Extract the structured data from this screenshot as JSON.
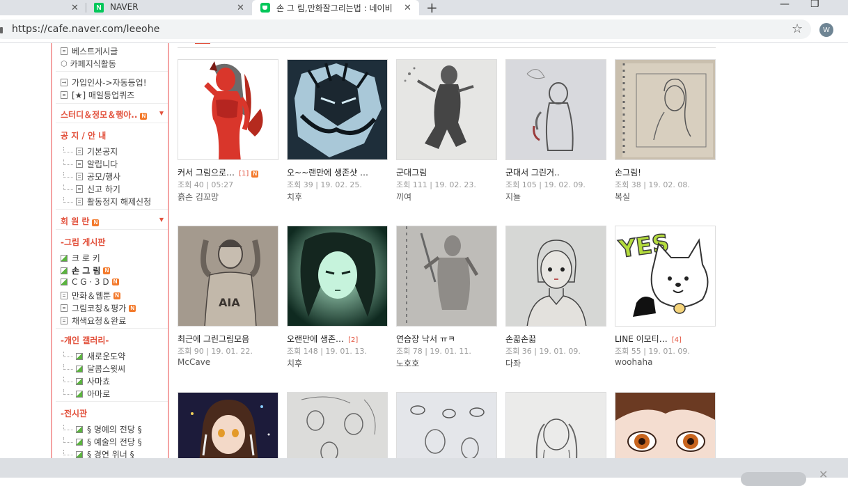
{
  "browser": {
    "tabs": [
      {
        "title": "",
        "close": "✕"
      },
      {
        "title": "NAVER",
        "favicon": "N",
        "close": "✕"
      },
      {
        "title": "손 그 림,만화잘그리는법 : 네이비",
        "close": "✕"
      }
    ],
    "new_tab": "+",
    "window_controls": {
      "minimize": "—",
      "restore": "❐",
      "close": "✕"
    },
    "url": "https://cafe.naver.com/leeohe",
    "profile_initial": "W"
  },
  "sidebar": {
    "top_items": [
      "베스트게시글",
      "카페지식활동"
    ],
    "mid_items": [
      "가입인사->자동등업!",
      "[★] 매일등업퀴즈"
    ],
    "sections": [
      {
        "title": "스터디＆정모＆행아..",
        "badge": "N"
      },
      {
        "title": "공 지 / 안 내",
        "items": [
          "기본공지",
          "알립니다",
          "공모/행사",
          "신고 하기",
          "활동정지 해제신청"
        ]
      },
      {
        "title": "회 원 란",
        "badge": "N"
      },
      {
        "title": "-그림 게시판",
        "items": [
          {
            "label": "크 로 키",
            "icon": "picture-icon",
            "new": false
          },
          {
            "label": "손 그 림",
            "icon": "picture-icon",
            "new": true,
            "bold": true
          },
          {
            "label": "C G · 3 D",
            "icon": "picture-icon",
            "new": true
          },
          {
            "label": "만화＆웹툰",
            "icon": "doc-icon",
            "new": true
          },
          {
            "label": "그림코칭＆평가",
            "icon": "doc-icon",
            "new": true
          },
          {
            "label": "채색요청＆완료",
            "icon": "doc-icon",
            "new": false
          }
        ]
      },
      {
        "title": "-개인 갤러리-",
        "items": [
          "새로운도약",
          "달콤스윗씨",
          "사마쵸",
          "아마로"
        ]
      },
      {
        "title": "-전시관",
        "items": [
          "§ 명예의 전당 §",
          "§ 예술의 전당 §",
          "§ 경연 위너 §"
        ]
      }
    ],
    "new_badge": "N"
  },
  "gallery": {
    "rows": [
      [
        {
          "title": "커서 그림으로…",
          "comments": "[1]",
          "new": true,
          "meta": "조회 40  |  05:27",
          "author": "흙손 김꼬망",
          "thumb": "red-demon-girl"
        },
        {
          "title": "오~~랜만에 생존샷 …",
          "comments": "",
          "new": false,
          "meta": "조회 39  |  19. 02. 25.",
          "author": "치후",
          "thumb": "armored-knight"
        },
        {
          "title": "군대그림",
          "comments": "",
          "new": false,
          "meta": "조회 111  |  19. 02. 23.",
          "author": "끼여",
          "thumb": "pencil-figure"
        },
        {
          "title": "군대서 그린거..",
          "comments": "",
          "new": false,
          "meta": "조회 105  |  19. 02. 09.",
          "author": "지뇰",
          "thumb": "pencil-elf"
        },
        {
          "title": "손그림!",
          "comments": "",
          "new": false,
          "meta": "조회 38  |  19. 02. 08.",
          "author": "복실",
          "thumb": "sketchbook-girl"
        }
      ],
      [
        {
          "title": "최근에 그린그림모음",
          "comments": "",
          "new": false,
          "meta": "조회 90  |  19. 01. 22.",
          "author": "McCave",
          "thumb": "pencil-man"
        },
        {
          "title": "오랜만에 생존…",
          "comments": "[2]",
          "new": false,
          "meta": "조회 148  |  19. 01. 13.",
          "author": "치후",
          "thumb": "green-girl"
        },
        {
          "title": "연습장 낙서 ㅠㅋ",
          "comments": "",
          "new": false,
          "meta": "조회 78  |  19. 01. 11.",
          "author": "노호호",
          "thumb": "pencil-warrior"
        },
        {
          "title": "손끏손끏",
          "comments": "",
          "new": false,
          "meta": "조회 36  |  19. 01. 09.",
          "author": "다좌",
          "thumb": "girl-portrait"
        },
        {
          "title": "LINE 이모티…",
          "comments": "[4]",
          "new": false,
          "meta": "조회 55  |  19. 01. 09.",
          "author": "woohaha",
          "thumb": "yes-cat"
        }
      ],
      [
        {
          "thumb": "anime-girl-dark"
        },
        {
          "thumb": "sketch-people"
        },
        {
          "thumb": "sketch-eyes"
        },
        {
          "thumb": "sketch-twintail"
        },
        {
          "thumb": "painted-eyes"
        }
      ]
    ],
    "yes_text": "YES"
  },
  "colors": {
    "accent": "#e2513c",
    "sidebar_border": "#f4a3a3",
    "naver_green": "#03c75a",
    "new_badge": "#f37a2c"
  }
}
